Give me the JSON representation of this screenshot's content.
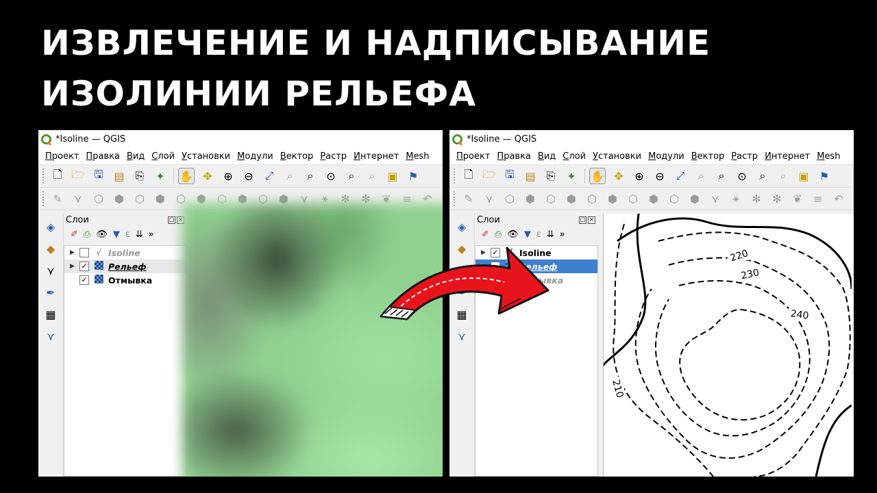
{
  "headline": {
    "line1": "ИЗВЛЕЧЕНИЕ И НАДПИСЫВАНИЕ",
    "line2": "ИЗОЛИНИИ РЕЛЬЕФА"
  },
  "window": {
    "title": "*Isoline — QGIS",
    "menu": [
      "Проект",
      "Правка",
      "Вид",
      "Слой",
      "Установки",
      "Модули",
      "Вектор",
      "Растр",
      "Интернет",
      "Mesh"
    ],
    "layers_panel_title": "Слои",
    "overflow_glyph": "»"
  },
  "layers_left": [
    {
      "name": "Isoline",
      "checked": false
    },
    {
      "name": "Рельеф",
      "checked": true
    },
    {
      "name": "Отмывка",
      "checked": true
    }
  ],
  "layers_right": [
    {
      "name": "Isoline",
      "checked": true
    },
    {
      "name": "Рельеф",
      "checked": false
    },
    {
      "name": "Отмывка",
      "checked": false
    }
  ],
  "contour_labels": [
    "220",
    "230",
    "240",
    "210"
  ],
  "colors": {
    "accent": "#3e7fd0",
    "arrow_red": "#e8141c",
    "qgis_green": "#589632"
  },
  "icons": [
    "new-project-icon",
    "open-icon",
    "save-icon",
    "pan-icon",
    "zoom-in-icon",
    "zoom-out-icon"
  ]
}
